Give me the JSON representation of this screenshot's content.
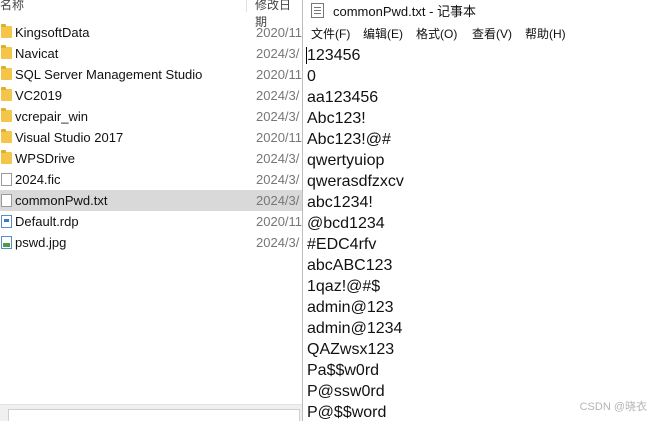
{
  "explorer": {
    "header": {
      "name": "名称",
      "date": "修改日期"
    },
    "items": [
      {
        "name": "KingsoftData",
        "date": "2020/11",
        "kind": "folder"
      },
      {
        "name": "Navicat",
        "date": "2024/3/",
        "kind": "folder"
      },
      {
        "name": "SQL Server Management Studio",
        "date": "2020/11",
        "kind": "folder"
      },
      {
        "name": "VC2019",
        "date": "2024/3/",
        "kind": "folder"
      },
      {
        "name": "vcrepair_win",
        "date": "2024/3/",
        "kind": "folder"
      },
      {
        "name": "Visual Studio 2017",
        "date": "2020/11",
        "kind": "folder"
      },
      {
        "name": "WPSDrive",
        "date": "2024/3/",
        "kind": "folder"
      },
      {
        "name": "2024.fic",
        "date": "2024/3/",
        "kind": "file"
      },
      {
        "name": "commonPwd.txt",
        "date": "2024/3/",
        "kind": "file",
        "selected": true
      },
      {
        "name": "Default.rdp",
        "date": "2020/11",
        "kind": "rdp"
      },
      {
        "name": "pswd.jpg",
        "date": "2024/3/",
        "kind": "image"
      }
    ]
  },
  "notepad": {
    "title": "commonPwd.txt - 记事本",
    "menu": [
      "文件(F)",
      "编辑(E)",
      "格式(O)",
      "查看(V)",
      "帮助(H)"
    ],
    "lines": [
      "123456",
      "0",
      "aa123456",
      "Abc123!",
      "Abc123!@#",
      "qwertyuiop",
      "qwerasdfzxcv",
      "abc1234!",
      "@bcd1234",
      "#EDC4rfv",
      "abcABC123",
      "1qaz!@#$",
      "admin@123",
      "admin@1234",
      "QAZwsx123",
      "Pa$$w0rd",
      "P@ssw0rd",
      "P@$$word"
    ]
  },
  "watermark": "CSDN @晓衣"
}
